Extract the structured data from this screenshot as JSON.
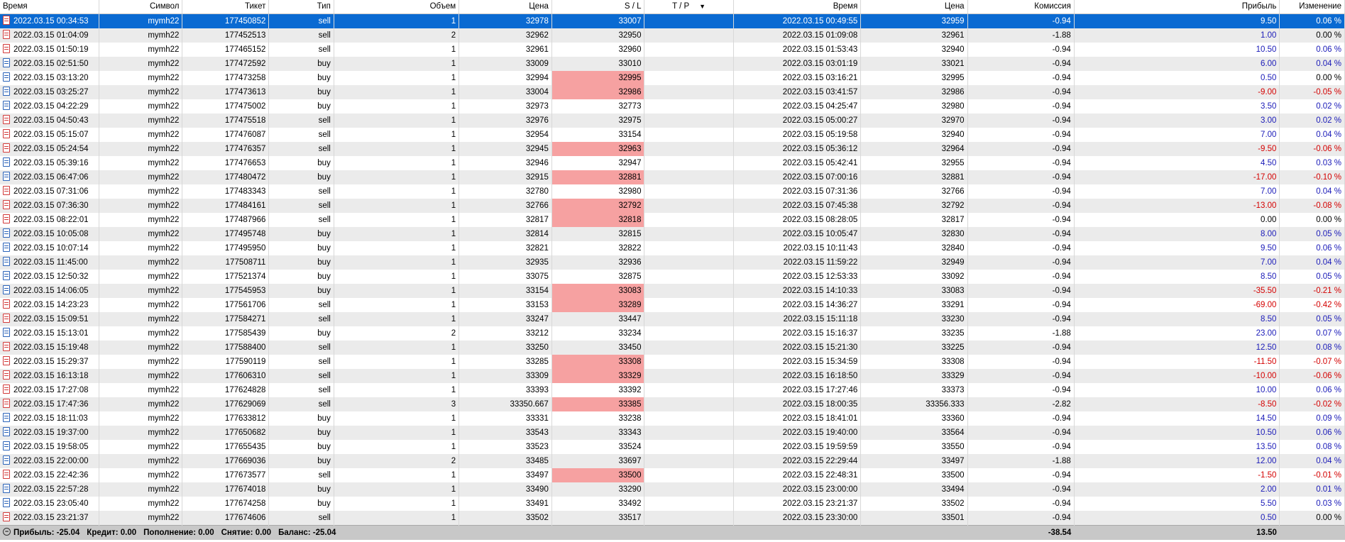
{
  "headers": {
    "open_time": "Время",
    "symbol": "Символ",
    "ticket": "Тикет",
    "type": "Тип",
    "volume": "Объем",
    "open_price": "Цена",
    "sl": "S / L",
    "tp": "T / P",
    "close_time": "Время",
    "close_price": "Цена",
    "commission": "Комиссия",
    "profit": "Прибыль",
    "change": "Изменение"
  },
  "rows": [
    {
      "open_time": "2022.03.15 00:34:53",
      "symbol": "mymh22",
      "ticket": "177450852",
      "type": "sell",
      "volume": "1",
      "open_price": "32978",
      "sl": "33007",
      "sl_hit": false,
      "tp": "",
      "close_time": "2022.03.15 00:49:55",
      "close_price": "32959",
      "commission": "-0.94",
      "profit": "9.50",
      "change": "0.06 %",
      "selected": true
    },
    {
      "open_time": "2022.03.15 01:04:09",
      "symbol": "mymh22",
      "ticket": "177452513",
      "type": "sell",
      "volume": "2",
      "open_price": "32962",
      "sl": "32950",
      "sl_hit": false,
      "tp": "",
      "close_time": "2022.03.15 01:09:08",
      "close_price": "32961",
      "commission": "-1.88",
      "profit": "1.00",
      "change": "0.00 %"
    },
    {
      "open_time": "2022.03.15 01:50:19",
      "symbol": "mymh22",
      "ticket": "177465152",
      "type": "sell",
      "volume": "1",
      "open_price": "32961",
      "sl": "32960",
      "sl_hit": false,
      "tp": "",
      "close_time": "2022.03.15 01:53:43",
      "close_price": "32940",
      "commission": "-0.94",
      "profit": "10.50",
      "change": "0.06 %"
    },
    {
      "open_time": "2022.03.15 02:51:50",
      "symbol": "mymh22",
      "ticket": "177472592",
      "type": "buy",
      "volume": "1",
      "open_price": "33009",
      "sl": "33010",
      "sl_hit": false,
      "tp": "",
      "close_time": "2022.03.15 03:01:19",
      "close_price": "33021",
      "commission": "-0.94",
      "profit": "6.00",
      "change": "0.04 %"
    },
    {
      "open_time": "2022.03.15 03:13:20",
      "symbol": "mymh22",
      "ticket": "177473258",
      "type": "buy",
      "volume": "1",
      "open_price": "32994",
      "sl": "32995",
      "sl_hit": true,
      "tp": "",
      "close_time": "2022.03.15 03:16:21",
      "close_price": "32995",
      "commission": "-0.94",
      "profit": "0.50",
      "change": "0.00 %"
    },
    {
      "open_time": "2022.03.15 03:25:27",
      "symbol": "mymh22",
      "ticket": "177473613",
      "type": "buy",
      "volume": "1",
      "open_price": "33004",
      "sl": "32986",
      "sl_hit": true,
      "tp": "",
      "close_time": "2022.03.15 03:41:57",
      "close_price": "32986",
      "commission": "-0.94",
      "profit": "-9.00",
      "change": "-0.05 %"
    },
    {
      "open_time": "2022.03.15 04:22:29",
      "symbol": "mymh22",
      "ticket": "177475002",
      "type": "buy",
      "volume": "1",
      "open_price": "32973",
      "sl": "32773",
      "sl_hit": false,
      "tp": "",
      "close_time": "2022.03.15 04:25:47",
      "close_price": "32980",
      "commission": "-0.94",
      "profit": "3.50",
      "change": "0.02 %"
    },
    {
      "open_time": "2022.03.15 04:50:43",
      "symbol": "mymh22",
      "ticket": "177475518",
      "type": "sell",
      "volume": "1",
      "open_price": "32976",
      "sl": "32975",
      "sl_hit": false,
      "tp": "",
      "close_time": "2022.03.15 05:00:27",
      "close_price": "32970",
      "commission": "-0.94",
      "profit": "3.00",
      "change": "0.02 %"
    },
    {
      "open_time": "2022.03.15 05:15:07",
      "symbol": "mymh22",
      "ticket": "177476087",
      "type": "sell",
      "volume": "1",
      "open_price": "32954",
      "sl": "33154",
      "sl_hit": false,
      "tp": "",
      "close_time": "2022.03.15 05:19:58",
      "close_price": "32940",
      "commission": "-0.94",
      "profit": "7.00",
      "change": "0.04 %"
    },
    {
      "open_time": "2022.03.15 05:24:54",
      "symbol": "mymh22",
      "ticket": "177476357",
      "type": "sell",
      "volume": "1",
      "open_price": "32945",
      "sl": "32963",
      "sl_hit": true,
      "tp": "",
      "close_time": "2022.03.15 05:36:12",
      "close_price": "32964",
      "commission": "-0.94",
      "profit": "-9.50",
      "change": "-0.06 %"
    },
    {
      "open_time": "2022.03.15 05:39:16",
      "symbol": "mymh22",
      "ticket": "177476653",
      "type": "buy",
      "volume": "1",
      "open_price": "32946",
      "sl": "32947",
      "sl_hit": false,
      "tp": "",
      "close_time": "2022.03.15 05:42:41",
      "close_price": "32955",
      "commission": "-0.94",
      "profit": "4.50",
      "change": "0.03 %"
    },
    {
      "open_time": "2022.03.15 06:47:06",
      "symbol": "mymh22",
      "ticket": "177480472",
      "type": "buy",
      "volume": "1",
      "open_price": "32915",
      "sl": "32881",
      "sl_hit": true,
      "tp": "",
      "close_time": "2022.03.15 07:00:16",
      "close_price": "32881",
      "commission": "-0.94",
      "profit": "-17.00",
      "change": "-0.10 %"
    },
    {
      "open_time": "2022.03.15 07:31:06",
      "symbol": "mymh22",
      "ticket": "177483343",
      "type": "sell",
      "volume": "1",
      "open_price": "32780",
      "sl": "32980",
      "sl_hit": false,
      "tp": "",
      "close_time": "2022.03.15 07:31:36",
      "close_price": "32766",
      "commission": "-0.94",
      "profit": "7.00",
      "change": "0.04 %"
    },
    {
      "open_time": "2022.03.15 07:36:30",
      "symbol": "mymh22",
      "ticket": "177484161",
      "type": "sell",
      "volume": "1",
      "open_price": "32766",
      "sl": "32792",
      "sl_hit": true,
      "tp": "",
      "close_time": "2022.03.15 07:45:38",
      "close_price": "32792",
      "commission": "-0.94",
      "profit": "-13.00",
      "change": "-0.08 %"
    },
    {
      "open_time": "2022.03.15 08:22:01",
      "symbol": "mymh22",
      "ticket": "177487966",
      "type": "sell",
      "volume": "1",
      "open_price": "32817",
      "sl": "32818",
      "sl_hit": true,
      "tp": "",
      "close_time": "2022.03.15 08:28:05",
      "close_price": "32817",
      "commission": "-0.94",
      "profit": "0.00",
      "change": "0.00 %"
    },
    {
      "open_time": "2022.03.15 10:05:08",
      "symbol": "mymh22",
      "ticket": "177495748",
      "type": "buy",
      "volume": "1",
      "open_price": "32814",
      "sl": "32815",
      "sl_hit": false,
      "tp": "",
      "close_time": "2022.03.15 10:05:47",
      "close_price": "32830",
      "commission": "-0.94",
      "profit": "8.00",
      "change": "0.05 %"
    },
    {
      "open_time": "2022.03.15 10:07:14",
      "symbol": "mymh22",
      "ticket": "177495950",
      "type": "buy",
      "volume": "1",
      "open_price": "32821",
      "sl": "32822",
      "sl_hit": false,
      "tp": "",
      "close_time": "2022.03.15 10:11:43",
      "close_price": "32840",
      "commission": "-0.94",
      "profit": "9.50",
      "change": "0.06 %"
    },
    {
      "open_time": "2022.03.15 11:45:00",
      "symbol": "mymh22",
      "ticket": "177508711",
      "type": "buy",
      "volume": "1",
      "open_price": "32935",
      "sl": "32936",
      "sl_hit": false,
      "tp": "",
      "close_time": "2022.03.15 11:59:22",
      "close_price": "32949",
      "commission": "-0.94",
      "profit": "7.00",
      "change": "0.04 %"
    },
    {
      "open_time": "2022.03.15 12:50:32",
      "symbol": "mymh22",
      "ticket": "177521374",
      "type": "buy",
      "volume": "1",
      "open_price": "33075",
      "sl": "32875",
      "sl_hit": false,
      "tp": "",
      "close_time": "2022.03.15 12:53:33",
      "close_price": "33092",
      "commission": "-0.94",
      "profit": "8.50",
      "change": "0.05 %"
    },
    {
      "open_time": "2022.03.15 14:06:05",
      "symbol": "mymh22",
      "ticket": "177545953",
      "type": "buy",
      "volume": "1",
      "open_price": "33154",
      "sl": "33083",
      "sl_hit": true,
      "tp": "",
      "close_time": "2022.03.15 14:10:33",
      "close_price": "33083",
      "commission": "-0.94",
      "profit": "-35.50",
      "change": "-0.21 %"
    },
    {
      "open_time": "2022.03.15 14:23:23",
      "symbol": "mymh22",
      "ticket": "177561706",
      "type": "sell",
      "volume": "1",
      "open_price": "33153",
      "sl": "33289",
      "sl_hit": true,
      "tp": "",
      "close_time": "2022.03.15 14:36:27",
      "close_price": "33291",
      "commission": "-0.94",
      "profit": "-69.00",
      "change": "-0.42 %"
    },
    {
      "open_time": "2022.03.15 15:09:51",
      "symbol": "mymh22",
      "ticket": "177584271",
      "type": "sell",
      "volume": "1",
      "open_price": "33247",
      "sl": "33447",
      "sl_hit": false,
      "tp": "",
      "close_time": "2022.03.15 15:11:18",
      "close_price": "33230",
      "commission": "-0.94",
      "profit": "8.50",
      "change": "0.05 %"
    },
    {
      "open_time": "2022.03.15 15:13:01",
      "symbol": "mymh22",
      "ticket": "177585439",
      "type": "buy",
      "volume": "2",
      "open_price": "33212",
      "sl": "33234",
      "sl_hit": false,
      "tp": "",
      "close_time": "2022.03.15 15:16:37",
      "close_price": "33235",
      "commission": "-1.88",
      "profit": "23.00",
      "change": "0.07 %"
    },
    {
      "open_time": "2022.03.15 15:19:48",
      "symbol": "mymh22",
      "ticket": "177588400",
      "type": "sell",
      "volume": "1",
      "open_price": "33250",
      "sl": "33450",
      "sl_hit": false,
      "tp": "",
      "close_time": "2022.03.15 15:21:30",
      "close_price": "33225",
      "commission": "-0.94",
      "profit": "12.50",
      "change": "0.08 %"
    },
    {
      "open_time": "2022.03.15 15:29:37",
      "symbol": "mymh22",
      "ticket": "177590119",
      "type": "sell",
      "volume": "1",
      "open_price": "33285",
      "sl": "33308",
      "sl_hit": true,
      "tp": "",
      "close_time": "2022.03.15 15:34:59",
      "close_price": "33308",
      "commission": "-0.94",
      "profit": "-11.50",
      "change": "-0.07 %"
    },
    {
      "open_time": "2022.03.15 16:13:18",
      "symbol": "mymh22",
      "ticket": "177606310",
      "type": "sell",
      "volume": "1",
      "open_price": "33309",
      "sl": "33329",
      "sl_hit": true,
      "tp": "",
      "close_time": "2022.03.15 16:18:50",
      "close_price": "33329",
      "commission": "-0.94",
      "profit": "-10.00",
      "change": "-0.06 %"
    },
    {
      "open_time": "2022.03.15 17:27:08",
      "symbol": "mymh22",
      "ticket": "177624828",
      "type": "sell",
      "volume": "1",
      "open_price": "33393",
      "sl": "33392",
      "sl_hit": false,
      "tp": "",
      "close_time": "2022.03.15 17:27:46",
      "close_price": "33373",
      "commission": "-0.94",
      "profit": "10.00",
      "change": "0.06 %"
    },
    {
      "open_time": "2022.03.15 17:47:36",
      "symbol": "mymh22",
      "ticket": "177629069",
      "type": "sell",
      "volume": "3",
      "open_price": "33350.667",
      "sl": "33385",
      "sl_hit": true,
      "tp": "",
      "close_time": "2022.03.15 18:00:35",
      "close_price": "33356.333",
      "commission": "-2.82",
      "profit": "-8.50",
      "change": "-0.02 %"
    },
    {
      "open_time": "2022.03.15 18:11:03",
      "symbol": "mymh22",
      "ticket": "177633812",
      "type": "buy",
      "volume": "1",
      "open_price": "33331",
      "sl": "33238",
      "sl_hit": false,
      "tp": "",
      "close_time": "2022.03.15 18:41:01",
      "close_price": "33360",
      "commission": "-0.94",
      "profit": "14.50",
      "change": "0.09 %"
    },
    {
      "open_time": "2022.03.15 19:37:00",
      "symbol": "mymh22",
      "ticket": "177650682",
      "type": "buy",
      "volume": "1",
      "open_price": "33543",
      "sl": "33343",
      "sl_hit": false,
      "tp": "",
      "close_time": "2022.03.15 19:40:00",
      "close_price": "33564",
      "commission": "-0.94",
      "profit": "10.50",
      "change": "0.06 %"
    },
    {
      "open_time": "2022.03.15 19:58:05",
      "symbol": "mymh22",
      "ticket": "177655435",
      "type": "buy",
      "volume": "1",
      "open_price": "33523",
      "sl": "33524",
      "sl_hit": false,
      "tp": "",
      "close_time": "2022.03.15 19:59:59",
      "close_price": "33550",
      "commission": "-0.94",
      "profit": "13.50",
      "change": "0.08 %"
    },
    {
      "open_time": "2022.03.15 22:00:00",
      "symbol": "mymh22",
      "ticket": "177669036",
      "type": "buy",
      "volume": "2",
      "open_price": "33485",
      "sl": "33697",
      "sl_hit": false,
      "tp": "",
      "close_time": "2022.03.15 22:29:44",
      "close_price": "33497",
      "commission": "-1.88",
      "profit": "12.00",
      "change": "0.04 %"
    },
    {
      "open_time": "2022.03.15 22:42:36",
      "symbol": "mymh22",
      "ticket": "177673577",
      "type": "sell",
      "volume": "1",
      "open_price": "33497",
      "sl": "33500",
      "sl_hit": true,
      "tp": "",
      "close_time": "2022.03.15 22:48:31",
      "close_price": "33500",
      "commission": "-0.94",
      "profit": "-1.50",
      "change": "-0.01 %"
    },
    {
      "open_time": "2022.03.15 22:57:28",
      "symbol": "mymh22",
      "ticket": "177674018",
      "type": "buy",
      "volume": "1",
      "open_price": "33490",
      "sl": "33290",
      "sl_hit": false,
      "tp": "",
      "close_time": "2022.03.15 23:00:00",
      "close_price": "33494",
      "commission": "-0.94",
      "profit": "2.00",
      "change": "0.01 %"
    },
    {
      "open_time": "2022.03.15 23:05:40",
      "symbol": "mymh22",
      "ticket": "177674258",
      "type": "buy",
      "volume": "1",
      "open_price": "33491",
      "sl": "33492",
      "sl_hit": false,
      "tp": "",
      "close_time": "2022.03.15 23:21:37",
      "close_price": "33502",
      "commission": "-0.94",
      "profit": "5.50",
      "change": "0.03 %"
    },
    {
      "open_time": "2022.03.15 23:21:37",
      "symbol": "mymh22",
      "ticket": "177674606",
      "type": "sell",
      "volume": "1",
      "open_price": "33502",
      "sl": "33517",
      "sl_hit": false,
      "tp": "",
      "close_time": "2022.03.15 23:30:00",
      "close_price": "33501",
      "commission": "-0.94",
      "profit": "0.50",
      "change": "0.00 %"
    }
  ],
  "summary": {
    "profit": "Прибыль: -25.04",
    "credit": "Кредит: 0.00",
    "deposit": "Пополнение: 0.00",
    "withdrawal": "Снятие: 0.00",
    "balance": "Баланс: -25.04",
    "total_commission": "-38.54",
    "total_profit": "13.50"
  },
  "colors": {
    "selected_row": "#0a6ad2",
    "sl_hit_cell": "#f6a1a1",
    "positive_profit": "#1a1ab8",
    "negative_profit": "#d40000",
    "buy_icon": "#2a62b8",
    "sell_icon": "#d23a3a",
    "footer": "#c8c8c8"
  },
  "icons": {
    "trade_row": "document-icon",
    "sort_indicator": "sort-down-icon",
    "summary_toggle": "collapse-minus-icon"
  }
}
